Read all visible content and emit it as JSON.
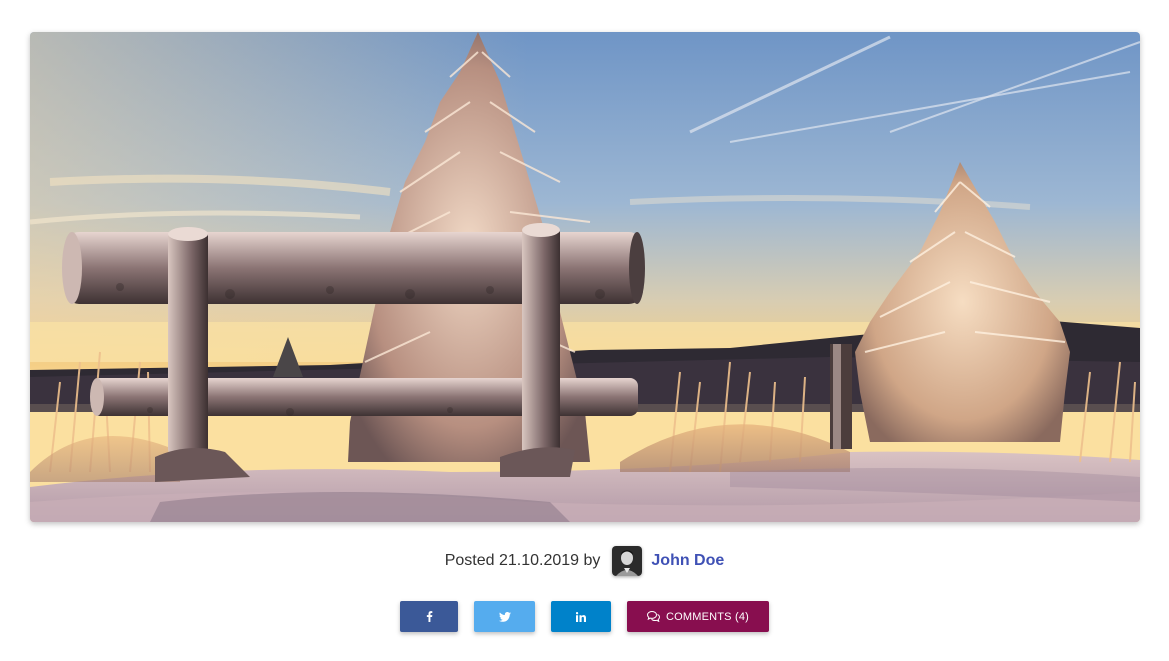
{
  "post": {
    "posted_label": "Posted 21.10.2019 by",
    "author": "John Doe"
  },
  "share": {
    "facebook": {
      "icon": "facebook-icon",
      "color": "#3b5998"
    },
    "twitter": {
      "icon": "twitter-icon",
      "color": "#55acee"
    },
    "linkedin": {
      "icon": "linkedin-icon",
      "color": "#0082ca"
    },
    "comments": {
      "icon": "comments-icon",
      "label": "COMMENTS (4)",
      "color": "#880e4f"
    }
  },
  "colors": {
    "author_link": "#3f51b5",
    "meta_text": "#333333"
  }
}
